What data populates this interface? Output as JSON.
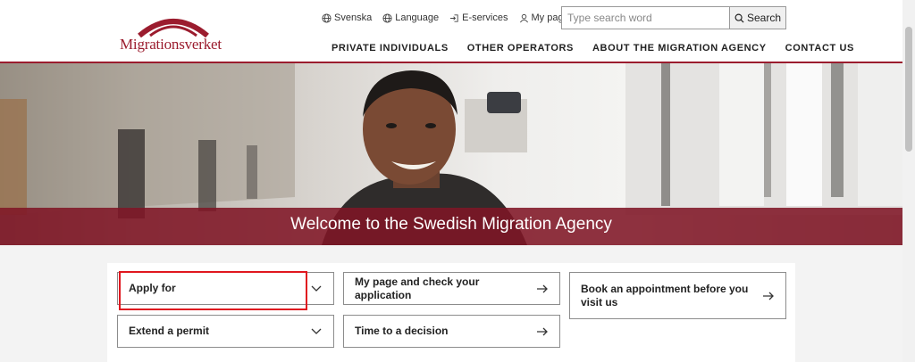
{
  "header": {
    "logo_text": "Migrationsverket",
    "top_links": [
      {
        "label": "Svenska",
        "icon": "globe-icon"
      },
      {
        "label": "Language",
        "icon": "globe-icon"
      },
      {
        "label": "E-services",
        "icon": "login-icon"
      },
      {
        "label": "My page",
        "icon": "user-icon"
      }
    ],
    "search": {
      "placeholder": "Type search word",
      "button_label": "Search"
    },
    "nav": [
      "PRIVATE INDIVIDUALS",
      "OTHER OPERATORS",
      "ABOUT THE MIGRATION AGENCY",
      "CONTACT US"
    ]
  },
  "hero": {
    "title": "Welcome to the Swedish Migration Agency"
  },
  "cards": [
    {
      "label": "Apply for",
      "icon": "chevron-down-icon"
    },
    {
      "label": "My page and check your application",
      "icon": "arrow-right-icon"
    },
    {
      "label": "Book an appointment before you visit us",
      "icon": "arrow-right-icon"
    },
    {
      "label": "Extend a permit",
      "icon": "chevron-down-icon"
    },
    {
      "label": "Time to a decision",
      "icon": "arrow-right-icon"
    }
  ],
  "colors": {
    "brand": "#9b1c2e",
    "hero_overlay": "#801626",
    "highlight": "#e0171f"
  }
}
